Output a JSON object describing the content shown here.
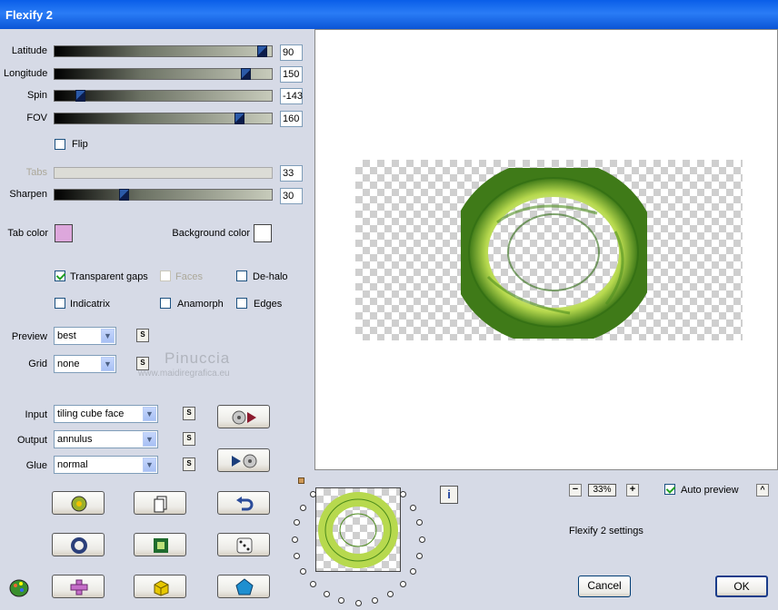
{
  "window": {
    "title": "Flexify 2"
  },
  "sliders": [
    {
      "label": "Latitude",
      "value": "90",
      "fraction": 0.98,
      "enabled": true
    },
    {
      "label": "Longitude",
      "value": "150",
      "fraction": 0.9,
      "enabled": true
    },
    {
      "label": "Spin",
      "value": "-143",
      "fraction": 0.1,
      "enabled": true
    },
    {
      "label": "FOV",
      "value": "160",
      "fraction": 0.87,
      "enabled": true
    }
  ],
  "flip": {
    "label": "Flip",
    "checked": false
  },
  "tabs": {
    "label": "Tabs",
    "value": "33",
    "enabled": false
  },
  "sharpen": {
    "label": "Sharpen",
    "value": "30",
    "fraction": 0.31
  },
  "colors": {
    "tab_label": "Tab color",
    "tab_color": "#dda7dc",
    "bg_label": "Background color",
    "bg_color": "#ffffff"
  },
  "options": {
    "transparent_gaps": {
      "label": "Transparent gaps",
      "checked": true
    },
    "faces": {
      "label": "Faces",
      "checked": false,
      "enabled": false
    },
    "de_halo": {
      "label": "De-halo",
      "checked": false
    },
    "indicatrix": {
      "label": "Indicatrix",
      "checked": false
    },
    "anamorph": {
      "label": "Anamorph",
      "checked": false
    },
    "edges": {
      "label": "Edges",
      "checked": false
    }
  },
  "selects": {
    "preview": {
      "label": "Preview",
      "value": "best"
    },
    "grid": {
      "label": "Grid",
      "value": "none"
    },
    "input": {
      "label": "Input",
      "value": "tiling cube face"
    },
    "output": {
      "label": "Output",
      "value": "annulus"
    },
    "glue": {
      "label": "Glue",
      "value": "normal"
    }
  },
  "small_button_label": "S",
  "watermark": {
    "name": "Pinuccia",
    "site": "www.maidiregrafica.eu"
  },
  "zoom": {
    "minus": "−",
    "value": "33%",
    "plus": "+"
  },
  "auto_preview": {
    "label": "Auto preview",
    "checked": true,
    "caret": "^"
  },
  "info_icon_label": "i",
  "settings_label": "Flexify 2 settings",
  "buttons": {
    "cancel": "Cancel",
    "ok": "OK"
  },
  "accent_colors": {
    "title_bar": "#0a5ee8",
    "ring_green": "#a9d43a"
  },
  "icons": [
    "input-preset-icon",
    "output-preset-icon",
    "randomize-icon",
    "copy-icon",
    "undo-icon",
    "reset-icon",
    "frame-icon",
    "dice-icon",
    "paint-icon",
    "cross-icon",
    "cube-icon",
    "gem-icon",
    "info-icon"
  ]
}
